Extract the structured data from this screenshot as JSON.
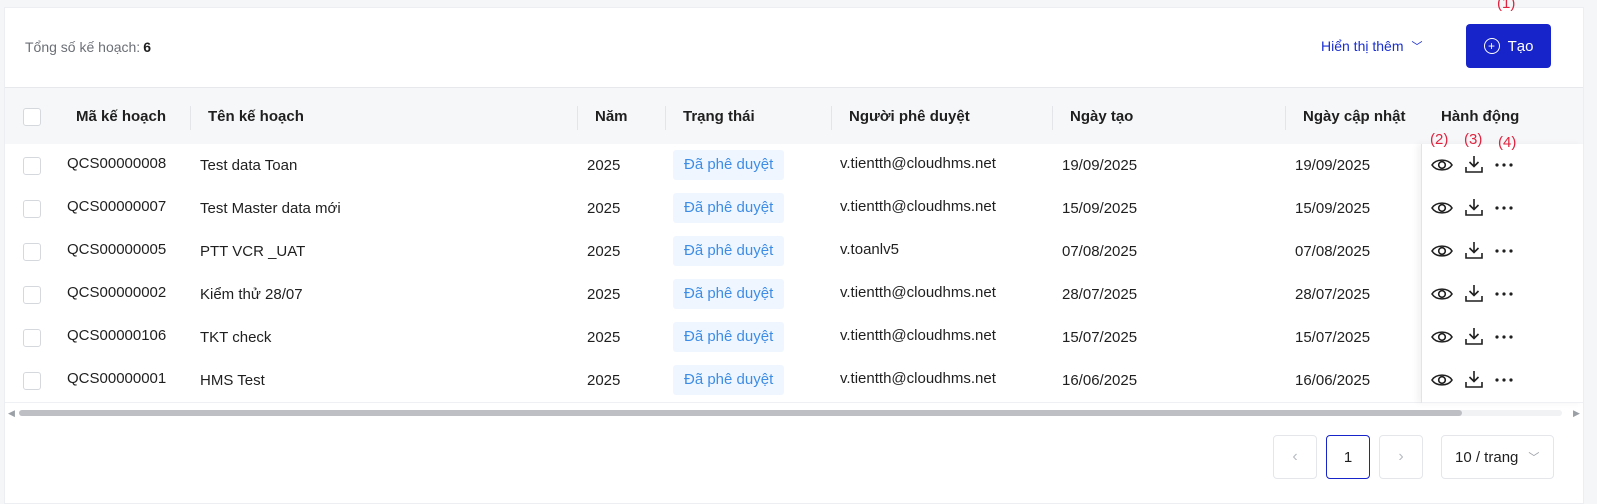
{
  "header": {
    "total_label": "Tổng số kế hoạch:",
    "total_count": "6",
    "show_more_label": "Hiển thị thêm",
    "create_label": "Tạo"
  },
  "annotations": [
    "(1)",
    "(2)",
    "(3)",
    "(4)"
  ],
  "table": {
    "columns": [
      "Mã kế hoạch",
      "Tên kế hoạch",
      "Năm",
      "Trạng thái",
      "Người phê duyệt",
      "Ngày tạo",
      "Ngày cập nhật",
      "Hành động"
    ],
    "rows": [
      {
        "code": "QCS00000008",
        "name": "Test data Toan",
        "year": "2025",
        "status": "Đã phê duyệt",
        "approver": "v.tientth@cloudhms.net",
        "created": "19/09/2025",
        "updated": "19/09/2025"
      },
      {
        "code": "QCS00000007",
        "name": "Test Master data mới",
        "year": "2025",
        "status": "Đã phê duyệt",
        "approver": "v.tientth@cloudhms.net",
        "created": "15/09/2025",
        "updated": "15/09/2025"
      },
      {
        "code": "QCS00000005",
        "name": "PTT VCR _UAT",
        "year": "2025",
        "status": "Đã phê duyệt",
        "approver": "v.toanlv5",
        "created": "07/08/2025",
        "updated": "07/08/2025"
      },
      {
        "code": "QCS00000002",
        "name": "Kiểm thử 28/07",
        "year": "2025",
        "status": "Đã phê duyệt",
        "approver": "v.tientth@cloudhms.net",
        "created": "28/07/2025",
        "updated": "28/07/2025"
      },
      {
        "code": "QCS00000106",
        "name": "TKT check",
        "year": "2025",
        "status": "Đã phê duyệt",
        "approver": "v.tientth@cloudhms.net",
        "created": "15/07/2025",
        "updated": "15/07/2025"
      },
      {
        "code": "QCS00000001",
        "name": "HMS Test",
        "year": "2025",
        "status": "Đã phê duyệt",
        "approver": "v.tientth@cloudhms.net",
        "created": "16/06/2025",
        "updated": "16/06/2025"
      }
    ],
    "row_actions": [
      "eye-icon",
      "download-icon",
      "more-icon"
    ]
  },
  "pagination": {
    "prev": "‹",
    "current_page": "1",
    "next": "›",
    "page_size": "10 / trang"
  },
  "colors": {
    "primary": "#1724c9",
    "status_text": "#3d8de6",
    "status_bg": "#f0f6ff",
    "annotation": "#e0243f"
  }
}
